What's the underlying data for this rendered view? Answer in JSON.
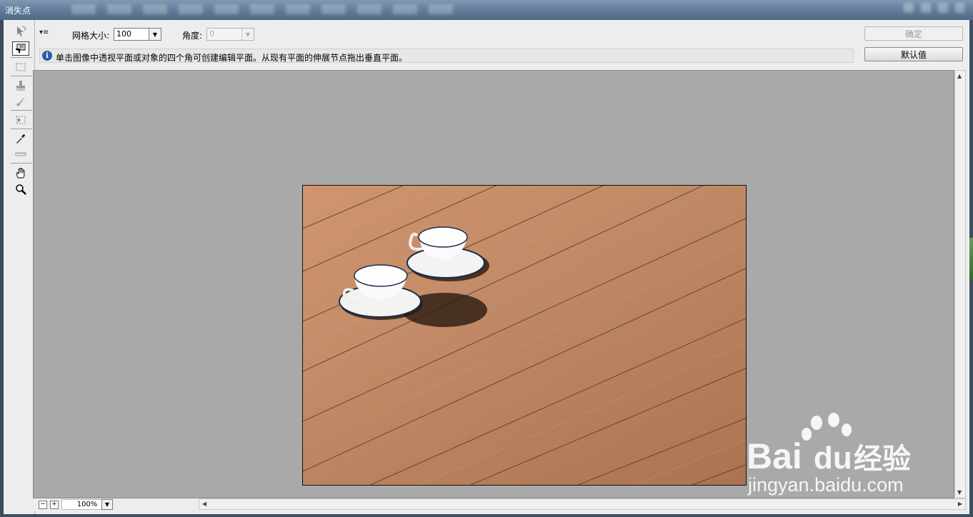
{
  "window": {
    "title": "消失点"
  },
  "toolbar": {
    "menu_glyph": "▾≡",
    "grid_size_label": "网格大小:",
    "grid_size_value": "100",
    "angle_label": "角度:",
    "angle_value": "0"
  },
  "info": {
    "message": "单击图像中透视平面或对象的四个角可创建编辑平面。从现有平面的伸展节点拖出垂直平面。"
  },
  "buttons": {
    "ok": "确定",
    "default": "默认值"
  },
  "status": {
    "zoom": "100%",
    "minus": "−",
    "plus": "+"
  },
  "tools": [
    "edit-plane-tool",
    "create-plane-tool",
    "marquee-tool",
    "stamp-tool",
    "brush-tool",
    "transform-tool",
    "eyedropper-tool",
    "measure-tool",
    "hand-tool",
    "zoom-tool"
  ],
  "watermark": {
    "brand": "Bai",
    "brand2": "du",
    "cn": "经验",
    "url": "jingyan.baidu.com"
  }
}
